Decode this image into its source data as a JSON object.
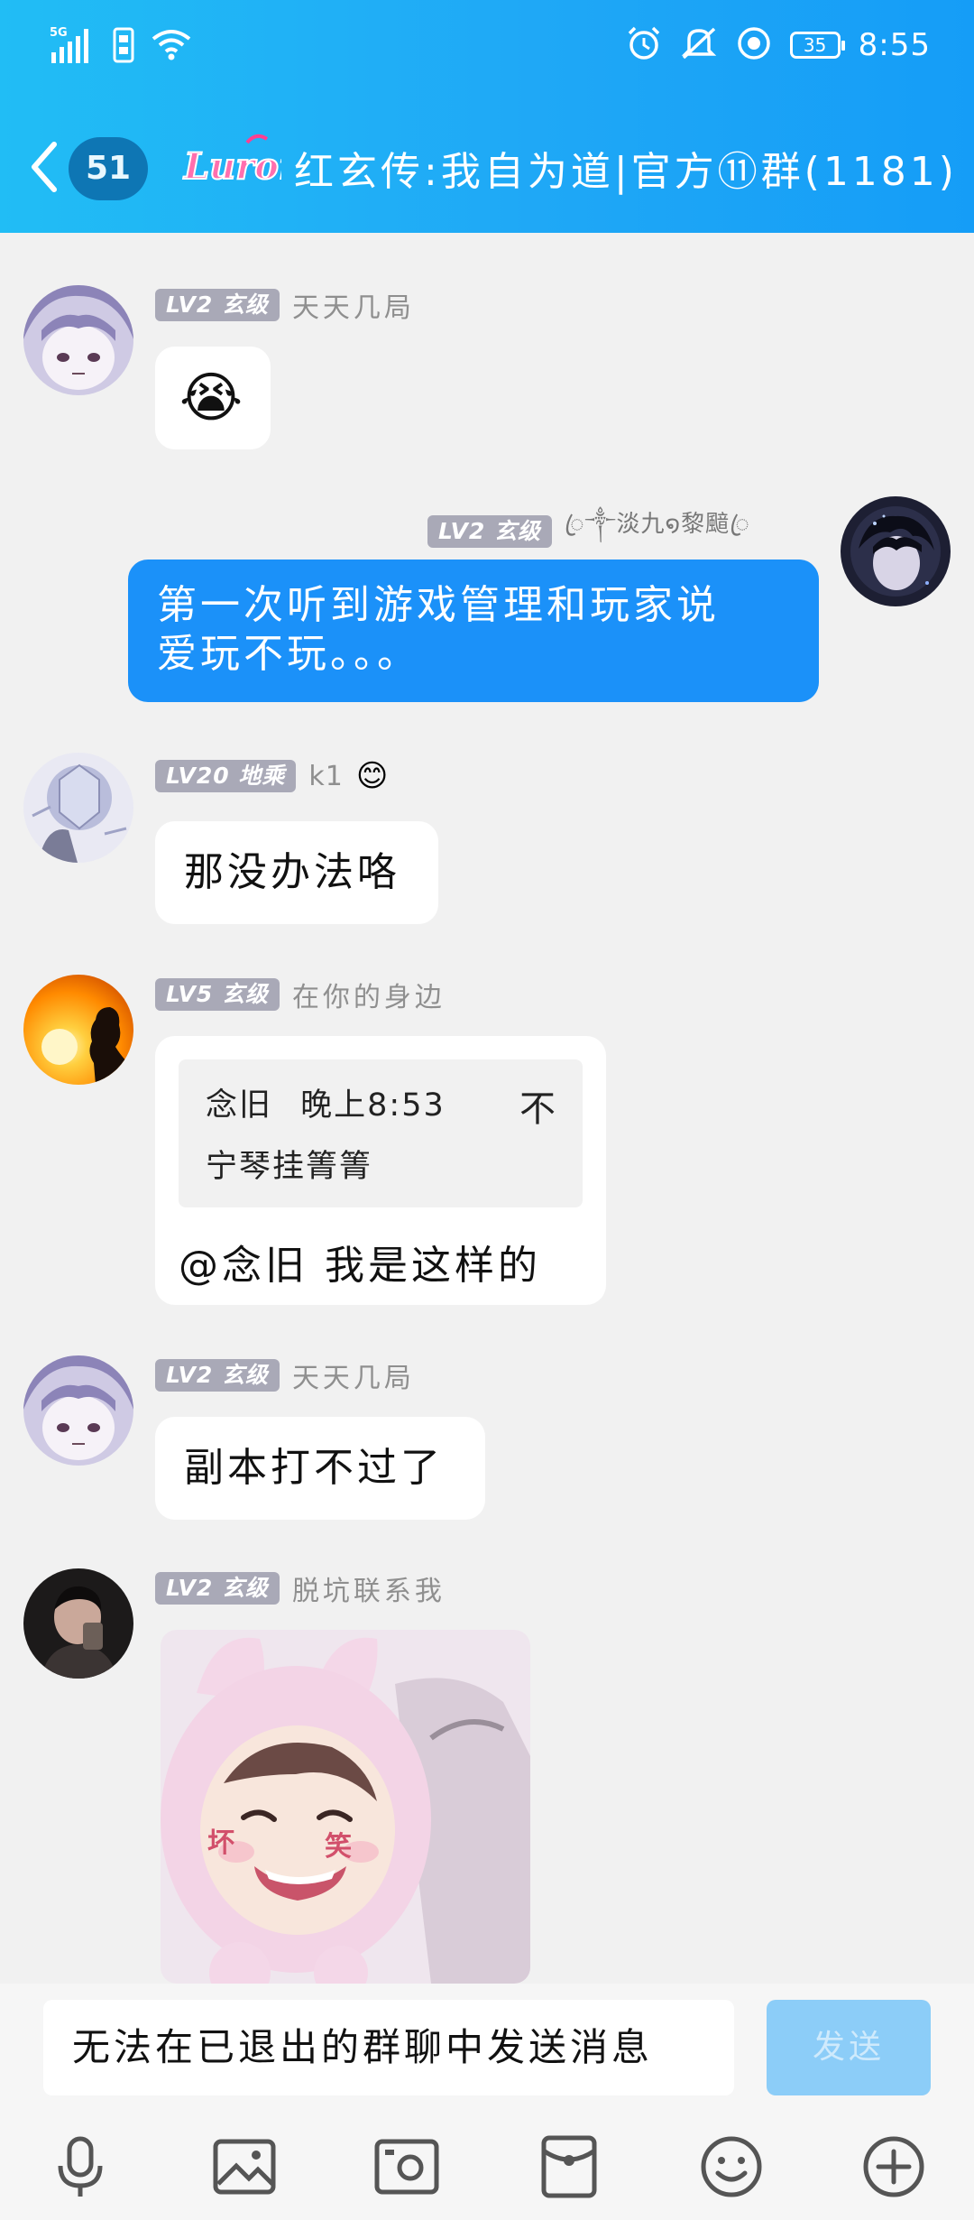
{
  "status_bar": {
    "network": "5G",
    "battery": "35",
    "time": "8:55"
  },
  "header": {
    "unread_count": "51",
    "logo_text": "Luron",
    "group_title": "红玄传:我自为道|官方⑪群(1181)"
  },
  "messages": [
    {
      "level": "LV2 玄级",
      "sender": "天天几局",
      "emoji": "😭"
    },
    {
      "level": "LV2 玄级",
      "sender": "ꦿ༒淡九໑黎䬓ꦿ",
      "text_line1": "第一次听到游戏管理和玩家说",
      "text_line2": "爱玩不玩。。。"
    },
    {
      "level": "LV20 地乘",
      "sender": "k1",
      "sender_badge": "😊",
      "text": "那没办法咯"
    },
    {
      "level": "LV5 玄级",
      "sender": "在你的身边",
      "quote_author": "念旧",
      "quote_time": "晚上8:53",
      "quote_line1": "不",
      "quote_line2": "宁琴挂箐箐",
      "text": "@念旧  我是这样的"
    },
    {
      "level": "LV2 玄级",
      "sender": "天天几局",
      "text": "副本打不过了"
    },
    {
      "level": "LV2 玄级",
      "sender": "脱坑联系我",
      "sticker_left": "坏",
      "sticker_right": "笑"
    }
  ],
  "input": {
    "text": "无法在已退出的群聊中发送消息",
    "send_label": "发送"
  },
  "colors": {
    "header_bg": "#1fa8f6",
    "my_bubble": "#1b91f9",
    "level_badge": "#a9a9b7",
    "send_disabled": "#8ccdf8"
  }
}
